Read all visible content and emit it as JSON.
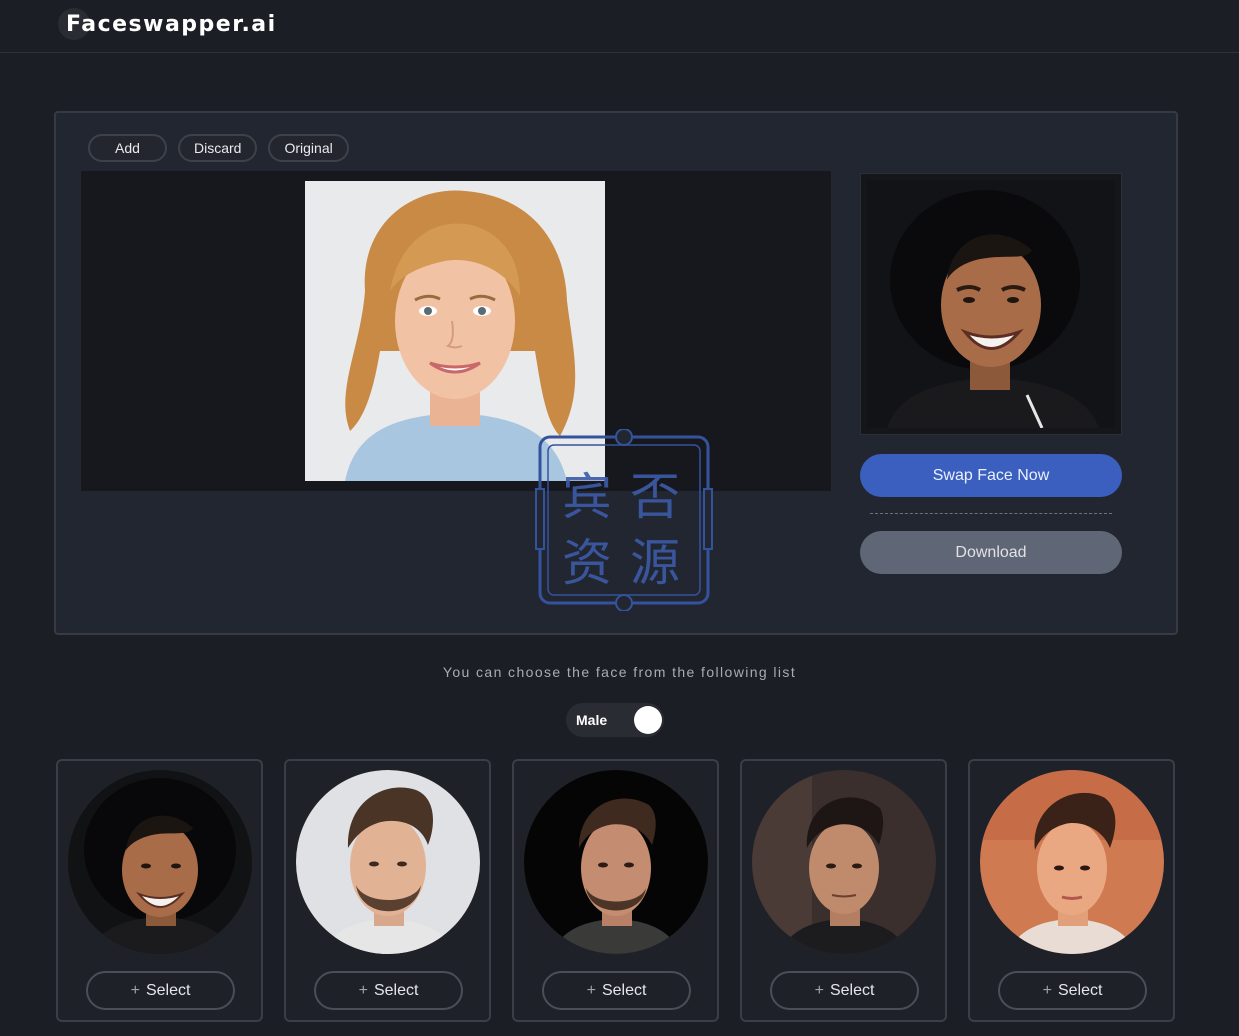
{
  "header": {
    "logo_text": "Faceswapper.ai"
  },
  "toolbar": {
    "add_label": "Add",
    "discard_label": "Discard",
    "original_label": "Original"
  },
  "actions": {
    "swap_label": "Swap Face Now",
    "download_label": "Download"
  },
  "watermark": {
    "chars": [
      "宾",
      "否",
      "资",
      "源"
    ]
  },
  "face_list": {
    "prompt": "You can choose the face from the following list",
    "gender_toggle_label": "Male",
    "plus_icon": "+",
    "items": [
      {
        "select_label": "Select"
      },
      {
        "select_label": "Select"
      },
      {
        "select_label": "Select"
      },
      {
        "select_label": "Select"
      },
      {
        "select_label": "Select"
      }
    ]
  },
  "colors": {
    "background": "#1c1e25",
    "panel": "#222630",
    "swap_button": "#3a5fbe",
    "download_button": "#5f6675",
    "watermark": "#3c5ba8"
  }
}
